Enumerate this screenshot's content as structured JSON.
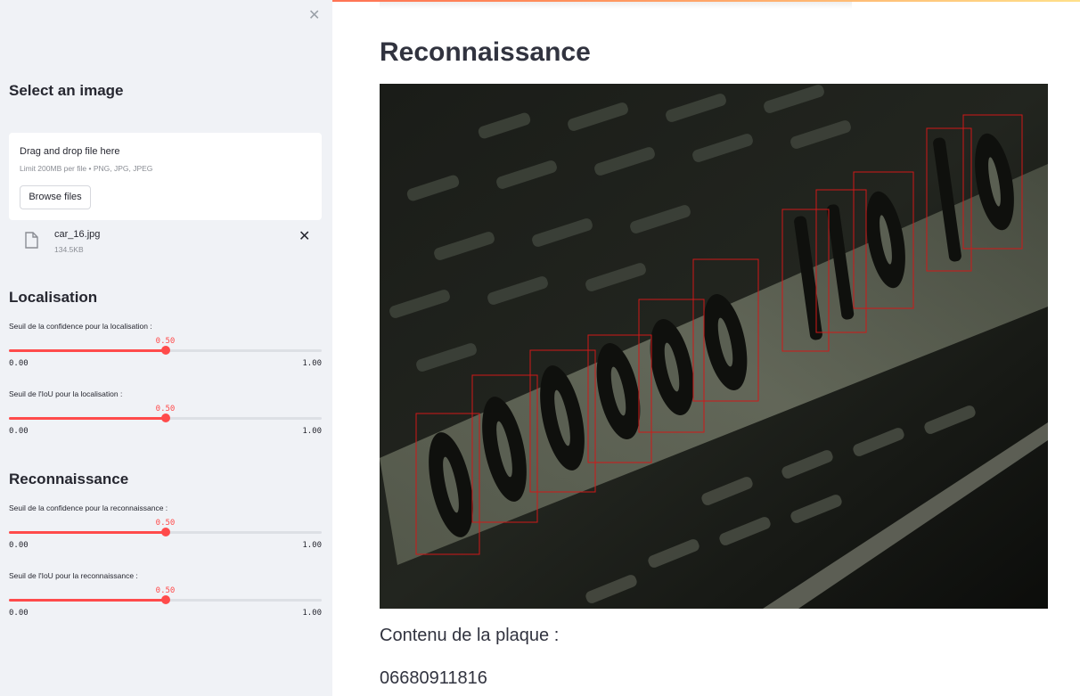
{
  "sidebar": {
    "close_icon": "close-icon",
    "title": "Select an image",
    "uploader": {
      "drag_text": "Drag and drop file here",
      "limit_text": "Limit 200MB per file • PNG, JPG, JPEG",
      "browse_label": "Browse files"
    },
    "file": {
      "name": "car_16.jpg",
      "size": "134.5KB",
      "icon": "file-icon",
      "remove_icon": "close-icon"
    },
    "localisation": {
      "heading": "Localisation",
      "confidence": {
        "label": "Seuil de la confidence pour la localisation :",
        "value": "0.50",
        "min": "0.00",
        "max": "1.00",
        "fraction": 0.5
      },
      "iou": {
        "label": "Seuil de l'IoU pour la localisation :",
        "value": "0.50",
        "min": "0.00",
        "max": "1.00",
        "fraction": 0.5
      }
    },
    "reconnaissance": {
      "heading": "Reconnaissance",
      "confidence": {
        "label": "Seuil de la confidence pour la reconnaissance :",
        "value": "0.50",
        "min": "0.00",
        "max": "1.00",
        "fraction": 0.5
      },
      "iou": {
        "label": "Seuil de l'IoU pour la reconnaissance :",
        "value": "0.50",
        "min": "0.00",
        "max": "1.00",
        "fraction": 0.5
      }
    }
  },
  "main": {
    "title": "Reconnaissance",
    "result_label": "Contenu de la plaque :",
    "result_value": "06680911816"
  },
  "colors": {
    "accent": "#ff4b4b",
    "sidebar_bg": "#f0f2f6",
    "detection_box": "#d01818"
  }
}
